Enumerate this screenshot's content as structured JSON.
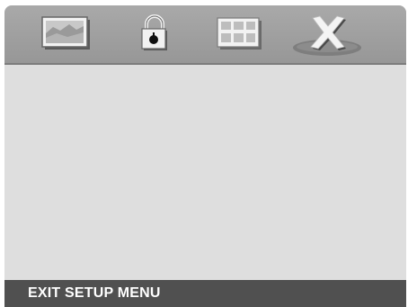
{
  "menu": {
    "tabs": [
      {
        "id": "picture",
        "icon": "picture-setup-icon",
        "selected": false
      },
      {
        "id": "password",
        "icon": "padlock-icon",
        "selected": false
      },
      {
        "id": "preference",
        "icon": "grid-panel-icon",
        "selected": false
      },
      {
        "id": "exit",
        "icon": "exit-x-icon",
        "selected": true
      }
    ]
  },
  "status": {
    "text": "EXIT SETUP MENU"
  },
  "colors": {
    "tabbar": "#a0a0a0",
    "content": "#dedede",
    "statusbar": "#505050",
    "status_text": "#ffffff",
    "selected_highlight": "#7e7e7e"
  }
}
